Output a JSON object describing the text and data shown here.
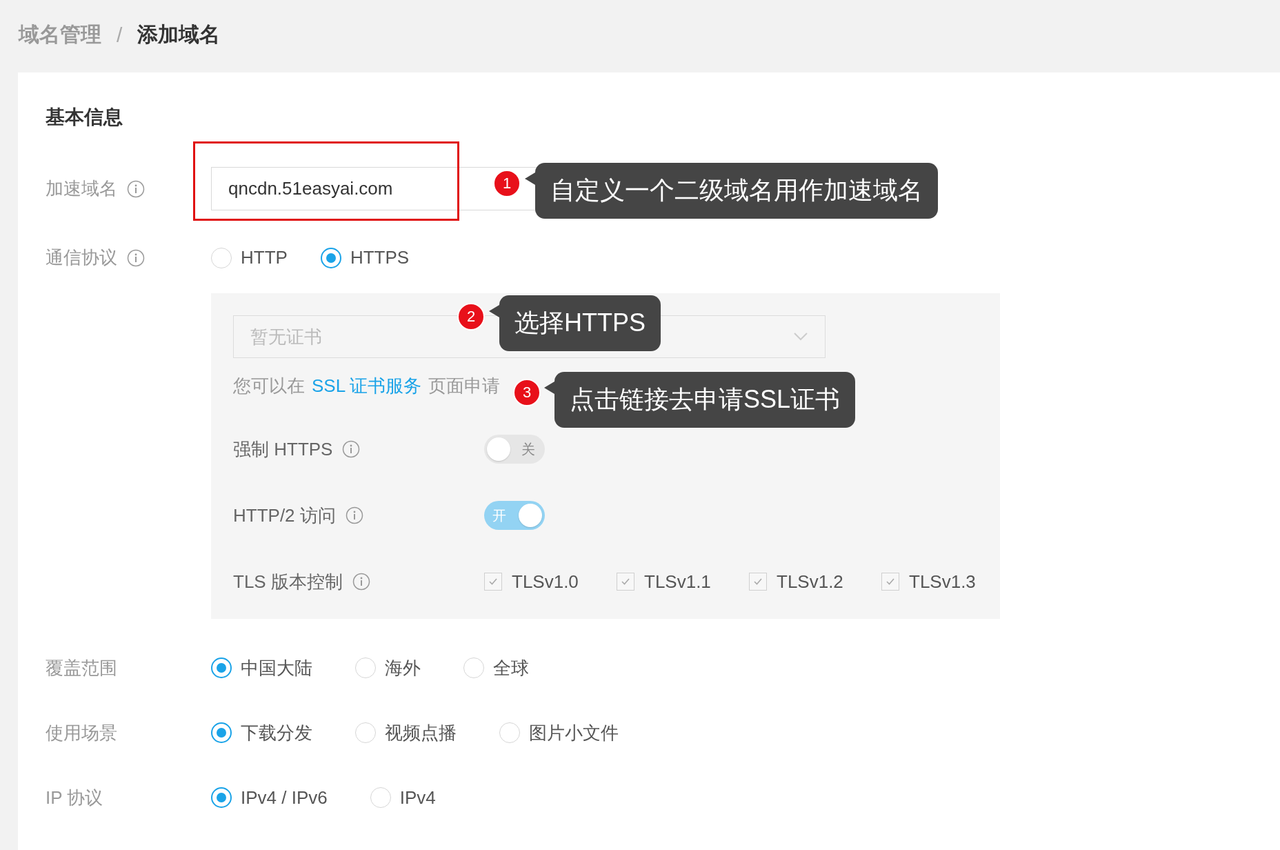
{
  "breadcrumb": [
    {
      "label": "域名管理",
      "current": false
    },
    {
      "label": "添加域名",
      "current": true
    }
  ],
  "breadcrumb_separator": "/",
  "section_title": "基本信息",
  "domain": {
    "label": "加速域名",
    "info": true,
    "value": "qncdn.51easyai.com",
    "highlighted": true
  },
  "protocol": {
    "label": "通信协议",
    "info": true,
    "options": [
      {
        "label": "HTTP",
        "selected": false
      },
      {
        "label": "HTTPS",
        "selected": true
      }
    ]
  },
  "https_panel": {
    "certificate_select": {
      "placeholder": "暂无证书"
    },
    "hint": {
      "before": "您可以在",
      "link": "SSL 证书服务",
      "after": "页面申请"
    },
    "rows": [
      {
        "kind": "toggle",
        "label": "强制 HTTPS",
        "info": true,
        "on": false,
        "text": "关"
      },
      {
        "kind": "toggle",
        "label": "HTTP/2 访问",
        "info": true,
        "on": true,
        "text": "开"
      },
      {
        "kind": "checkboxes",
        "label": "TLS 版本控制",
        "info": true,
        "options": [
          {
            "label": "TLSv1.0",
            "checked": true
          },
          {
            "label": "TLSv1.1",
            "checked": true
          },
          {
            "label": "TLSv1.2",
            "checked": true
          },
          {
            "label": "TLSv1.3",
            "checked": true
          }
        ]
      }
    ]
  },
  "radio_groups": [
    {
      "label": "覆盖范围",
      "options": [
        {
          "label": "中国大陆",
          "selected": true
        },
        {
          "label": "海外",
          "selected": false
        },
        {
          "label": "全球",
          "selected": false
        }
      ]
    },
    {
      "label": "使用场景",
      "options": [
        {
          "label": "下载分发",
          "selected": true
        },
        {
          "label": "视频点播",
          "selected": false
        },
        {
          "label": "图片小文件",
          "selected": false
        }
      ]
    },
    {
      "label": "IP 协议",
      "options": [
        {
          "label": "IPv4 / IPv6",
          "selected": true
        },
        {
          "label": "IPv4",
          "selected": false
        }
      ]
    }
  ],
  "annotations": [
    {
      "number": "1",
      "text": "自定义一个二级域名用作加速域名"
    },
    {
      "number": "2",
      "text": "选择HTTPS"
    },
    {
      "number": "3",
      "text": "点击链接去申请SSL证书"
    }
  ]
}
